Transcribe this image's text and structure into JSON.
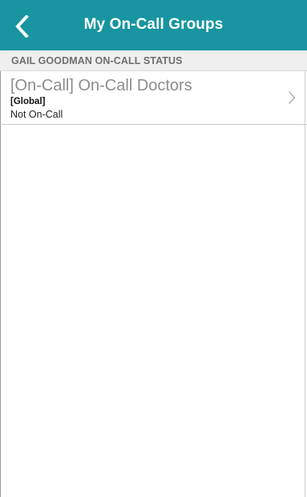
{
  "header": {
    "title": "My On-Call Groups",
    "back_icon": "chevron-left-icon",
    "background_color": "#1895a0"
  },
  "section": {
    "title": "GAIL GOODMAN ON-CALL STATUS"
  },
  "groups": [
    {
      "name": "[On-Call] On-Call Doctors",
      "scope": "[Global]",
      "status": "Not On-Call",
      "icon": "chevron-right-icon"
    }
  ]
}
